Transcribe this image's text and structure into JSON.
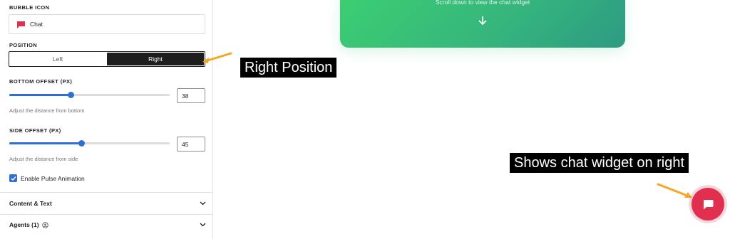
{
  "panel": {
    "bubble_icon_label": "BUBBLE ICON",
    "bubble_icon_value": "Chat",
    "position_label": "POSITION",
    "position_options": [
      "Left",
      "Right"
    ],
    "position_selected": "Right",
    "bottom_offset_label": "BOTTOM OFFSET (PX)",
    "bottom_offset_value": "38",
    "bottom_offset_help": "Adjust the distance from bottom",
    "side_offset_label": "SIDE OFFSET (PX)",
    "side_offset_value": "45",
    "side_offset_help": "Adjust the distance from side",
    "pulse_label": "Enable Pulse Animation",
    "pulse_checked": true,
    "accordions": [
      {
        "label": "Content & Text",
        "icon": "chevron-down-icon"
      },
      {
        "label": "Agents (1)",
        "icon": "chevron-down-icon"
      }
    ]
  },
  "preview": {
    "hero_text": "Scroll down to view the chat widget",
    "hero_arrow": "arrow-down-icon"
  },
  "annotations": {
    "right_position": "Right Position",
    "shows_widget": "Shows chat widget on right"
  },
  "colors": {
    "accent_blue": "#2f6fd1",
    "chat_red": "#e1304f",
    "hero_green": "#3ccf71",
    "arrow_orange": "#f5a623"
  },
  "sliders": {
    "bottom_offset_fraction": 0.38,
    "side_offset_fraction": 0.45
  }
}
